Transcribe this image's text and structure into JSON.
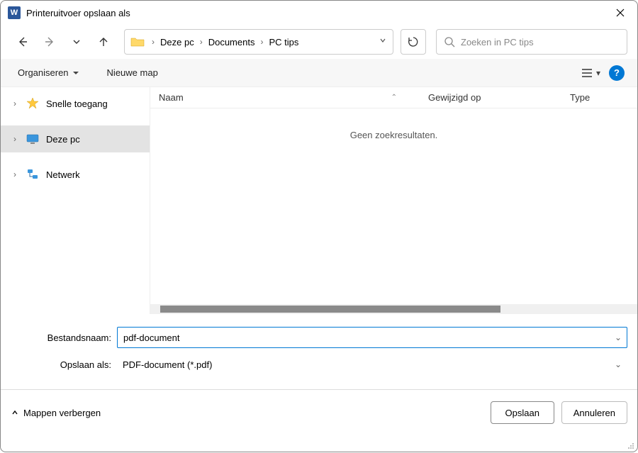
{
  "window": {
    "title": "Printeruitvoer opslaan als"
  },
  "breadcrumb": {
    "parts": [
      "Deze pc",
      "Documents",
      "PC tips"
    ]
  },
  "search": {
    "placeholder": "Zoeken in PC tips"
  },
  "toolbar": {
    "organize": "Organiseren",
    "new_folder": "Nieuwe map"
  },
  "sidebar": {
    "quick_access": "Snelle toegang",
    "this_pc": "Deze pc",
    "network": "Netwerk"
  },
  "columns": {
    "name": "Naam",
    "modified": "Gewijzigd op",
    "type": "Type"
  },
  "content": {
    "empty": "Geen zoekresultaten."
  },
  "form": {
    "filename_label": "Bestandsnaam:",
    "filename_value": "pdf-document",
    "saveas_label": "Opslaan als:",
    "saveas_value": "PDF-document (*.pdf)"
  },
  "bottom": {
    "hide_folders": "Mappen verbergen",
    "save": "Opslaan",
    "cancel": "Annuleren"
  }
}
